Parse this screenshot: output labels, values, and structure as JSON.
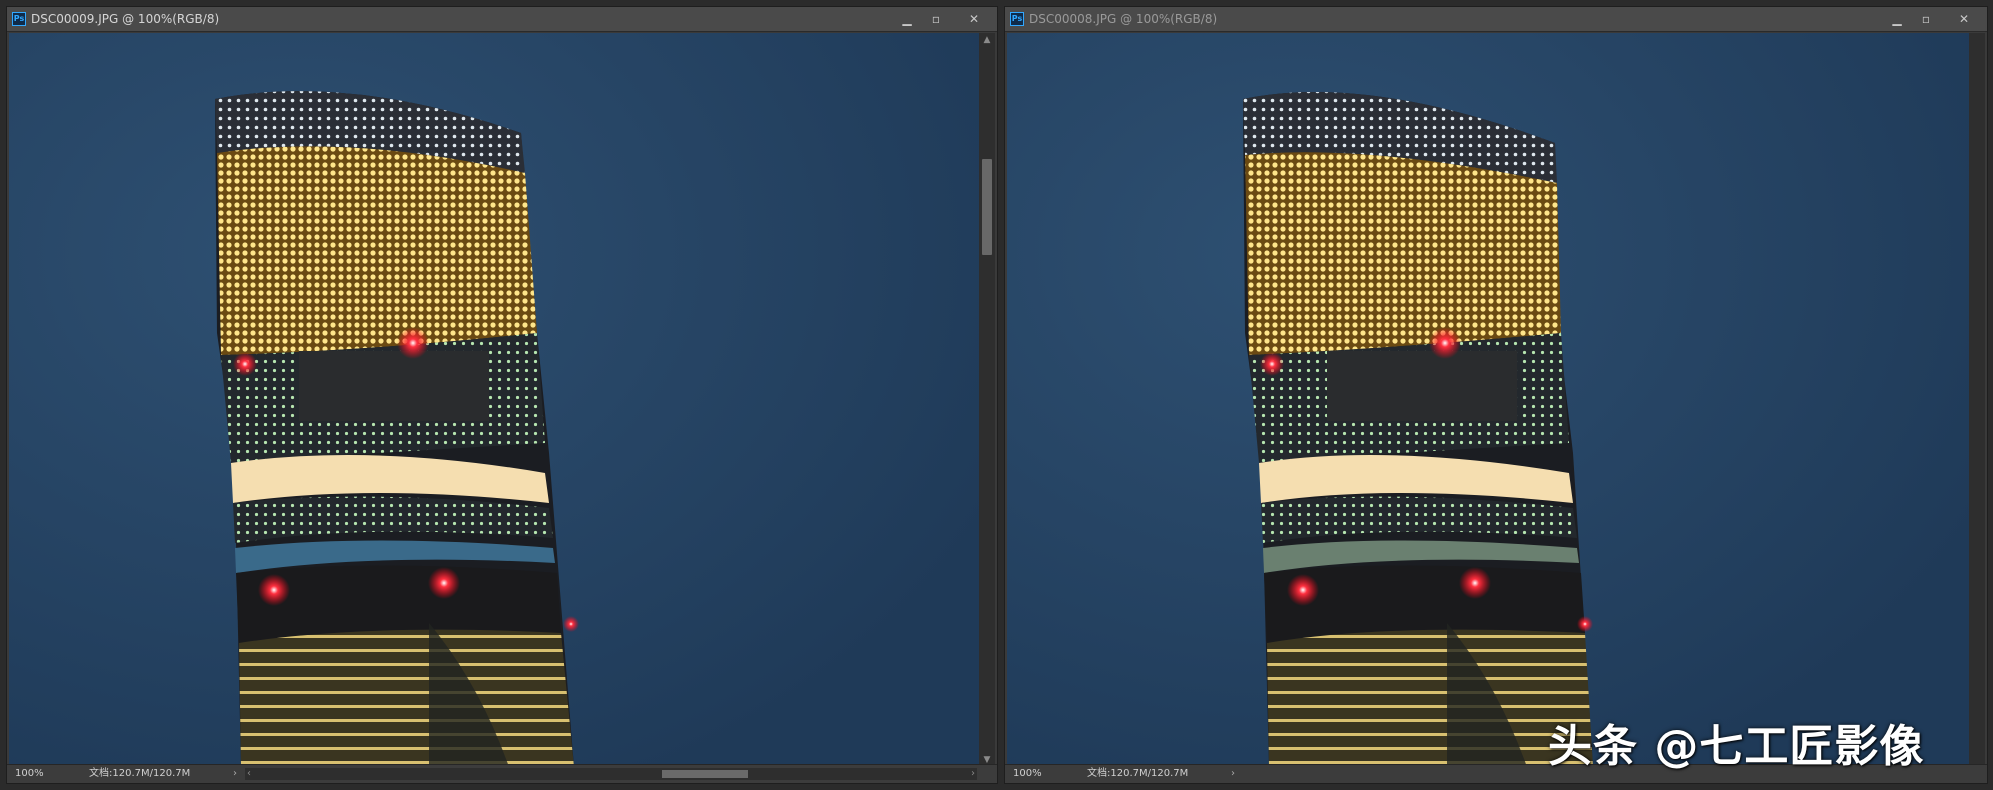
{
  "windows": {
    "left": {
      "title": "DSC00009.JPG @ 100%(RGB/8)",
      "zoom": "100%",
      "doc_info": "文档:120.7M/120.7M",
      "status_arrow": "›"
    },
    "right": {
      "title": "DSC00008.JPG @ 100%(RGB/8)",
      "zoom": "100%",
      "doc_info": "文档:120.7M/120.7M",
      "status_arrow": "›"
    }
  },
  "controls": {
    "minimize": "▁",
    "maximize": "▫",
    "close": "✕"
  },
  "app_icon_text": "Ps",
  "watermark": "头条 @七工匠影像",
  "colors": {
    "sky": "#24415f",
    "facade_yellow": "#e8c55a",
    "warning_light_red": "#ff2030",
    "window_chrome": "#3a3a3a"
  }
}
